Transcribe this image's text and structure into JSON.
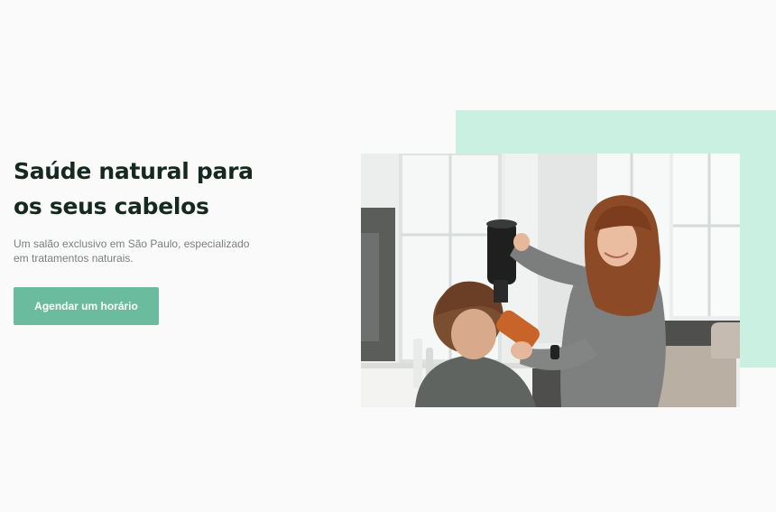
{
  "hero": {
    "title": "Saúde natural para os seus cabelos",
    "subtitle": "Um salão exclusivo em São Paulo, especializado em tratamentos naturais.",
    "cta_label": "Agendar um horário"
  },
  "colors": {
    "background": "#fafafa",
    "title": "#15291f",
    "subtitle": "#7a7f7c",
    "cta": "#6bbb9e",
    "accent_block": "#c9f0e0"
  }
}
